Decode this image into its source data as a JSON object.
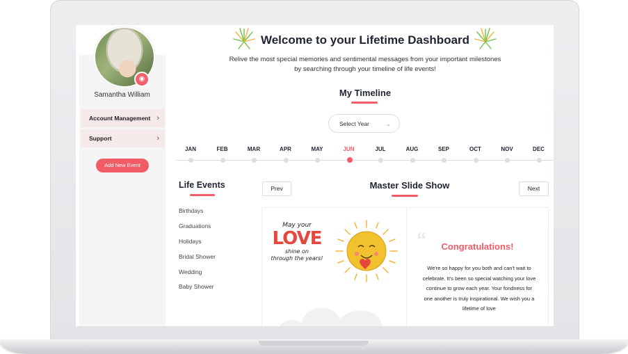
{
  "user": {
    "name": "Samantha William"
  },
  "sidebar": {
    "items": [
      {
        "label": "Account Management"
      },
      {
        "label": "Support"
      }
    ],
    "add_event_label": "Add New Event"
  },
  "header": {
    "title": "Welcome to your Lifetime Dashboard",
    "subtitle": "Relive the most special memories and sentimental messages from your important milestones by searching through your timeline of life events!"
  },
  "timeline": {
    "title": "My Timeline",
    "select_label": "Select Year",
    "months": [
      "JAN",
      "FEB",
      "MAR",
      "APR",
      "MAY",
      "JUN",
      "JUL",
      "AUG",
      "SEP",
      "OCT",
      "NOV",
      "DEC"
    ],
    "active_month": "JUN"
  },
  "life_events": {
    "title": "Life Events",
    "items": [
      "Birthdays",
      "Graduations",
      "Holidays",
      "Bridal Shower",
      "Wedding",
      "Baby Shower"
    ]
  },
  "slideshow": {
    "title": "Master Slide Show",
    "prev_label": "Prev",
    "next_label": "Next",
    "card_image": {
      "line1": "May your",
      "line2": "LOVE",
      "line3": "shine on",
      "line4": "through the years!"
    },
    "card_heading": "Congratulations!",
    "card_message": "We're so happy for you both and can't wait to celebrate. It's been so special watching your love continue to grow each year. Your fondness for one another is truly inspirational. We wish you a lifetime of love"
  },
  "colors": {
    "accent": "#f25c66",
    "dark_text": "#1f2433",
    "sidebar_item_bg": "#f6e9ea"
  }
}
